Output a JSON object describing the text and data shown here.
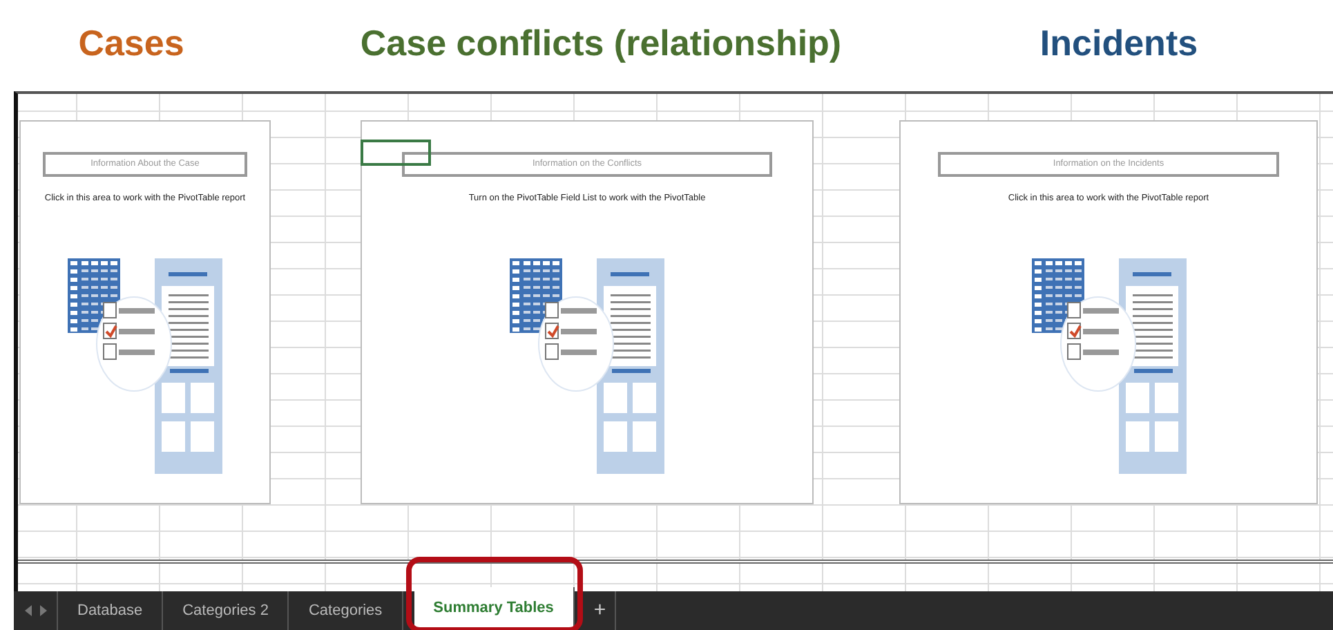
{
  "headings": [
    {
      "text": "Cases",
      "color": "#c8641e"
    },
    {
      "text": "Case conflicts (relationship)",
      "color": "#4a7030"
    },
    {
      "text": "Incidents",
      "color": "#22507e"
    }
  ],
  "panels": [
    {
      "field_label": "Information About the Case",
      "instruction": "Click in this area to work with the PivotTable report",
      "cell_selected": false
    },
    {
      "field_label": "Information on the Conflicts",
      "instruction": "Turn on the PivotTable Field List to work with the PivotTable",
      "cell_selected": true
    },
    {
      "field_label": "Information on the Incidents",
      "instruction": "Click in this area to work with the PivotTable report",
      "cell_selected": false
    }
  ],
  "sheet_tabs": [
    {
      "label": "Database",
      "selected": false,
      "highlighted": false
    },
    {
      "label": "Categories 2",
      "selected": false,
      "highlighted": false
    },
    {
      "label": "Categories",
      "selected": false,
      "highlighted": false
    },
    {
      "label": "Summary Tables",
      "selected": true,
      "highlighted": true
    }
  ],
  "add_tab": "+"
}
